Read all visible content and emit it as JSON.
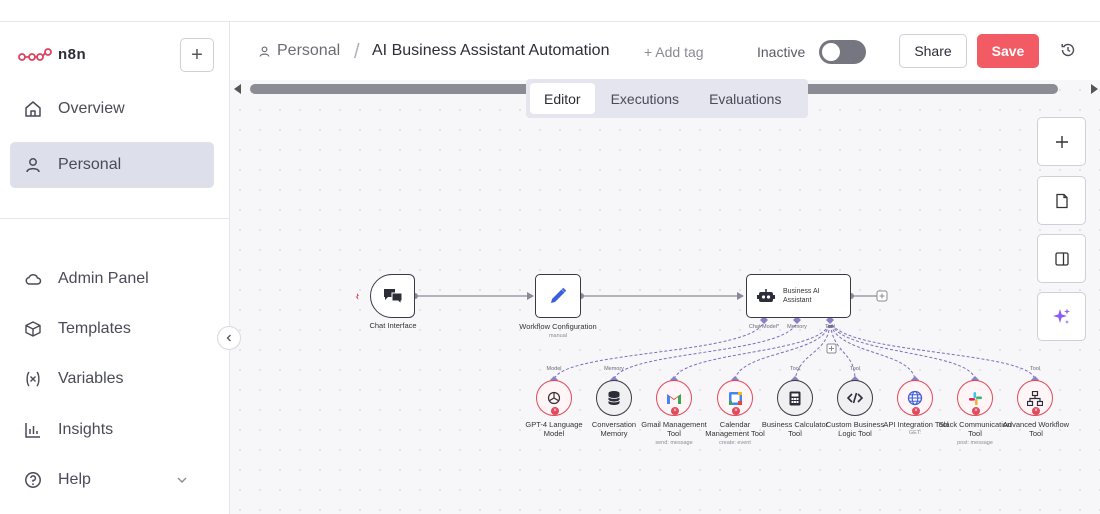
{
  "app": {
    "logo_text": "n8n"
  },
  "sidebar": {
    "items": [
      {
        "label": "Overview",
        "icon": "home-icon"
      },
      {
        "label": "Personal",
        "icon": "user-icon",
        "active": true
      },
      {
        "label": "Admin Panel",
        "icon": "cloud-icon"
      },
      {
        "label": "Templates",
        "icon": "box-icon"
      },
      {
        "label": "Variables",
        "icon": "variable-icon"
      },
      {
        "label": "Insights",
        "icon": "bar-chart-icon"
      },
      {
        "label": "Help",
        "icon": "help-icon"
      }
    ]
  },
  "header": {
    "crumb_project": "Personal",
    "separator": "/",
    "workflow_title": "AI Business Assistant Automation",
    "add_tag": "+ Add tag",
    "status_label": "Inactive",
    "active": false,
    "share_label": "Share",
    "save_label": "Save"
  },
  "tabs": [
    {
      "label": "Editor",
      "active": true
    },
    {
      "label": "Executions"
    },
    {
      "label": "Evaluations"
    }
  ],
  "nodes": {
    "chat": {
      "label": "Chat Interface"
    },
    "config": {
      "label": "Workflow Configuration",
      "sub": "manual"
    },
    "agent": {
      "label": "Business AI Assistant",
      "ports": [
        "Chat Model*",
        "Memory",
        "Tool"
      ]
    },
    "tools": [
      {
        "label": "GPT-4 Language Model",
        "port": "Model",
        "icon": "openai-icon",
        "status": "error"
      },
      {
        "label": "Conversation Memory",
        "port": "Memory",
        "icon": "database-icon",
        "status": "ok"
      },
      {
        "label": "Gmail Management Tool",
        "sub": "send: message",
        "icon": "gmail-icon",
        "status": "error"
      },
      {
        "label": "Calendar Management Tool",
        "sub": "create: event",
        "icon": "calendar-icon",
        "status": "error"
      },
      {
        "label": "Business Calculator Tool",
        "port": "Tool",
        "icon": "calculator-icon",
        "status": "ok"
      },
      {
        "label": "Custom Business Logic Tool",
        "port": "Tool",
        "icon": "code-icon",
        "status": "ok"
      },
      {
        "label": "API Integration Tool",
        "sub": "GET: ",
        "icon": "globe-icon",
        "status": "error"
      },
      {
        "label": "Slack Communication Tool",
        "sub": "post: message",
        "icon": "slack-icon",
        "status": "error"
      },
      {
        "label": "Advanced Workflow Tool",
        "port": "Tool",
        "icon": "workflow-icon",
        "status": "error"
      }
    ]
  },
  "colors": {
    "accent": "#f25b63",
    "error": "#e04a5c",
    "edge": "#7a6fb8"
  }
}
